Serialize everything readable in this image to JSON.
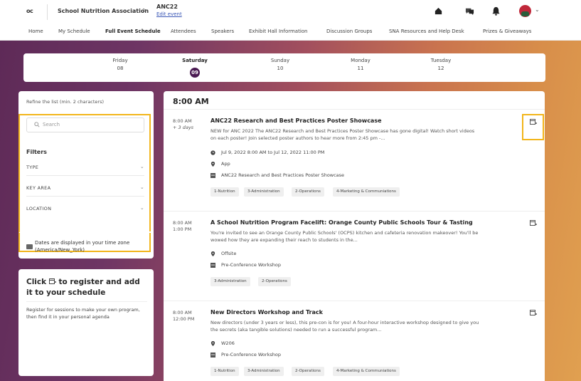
{
  "header": {
    "logo": "oc",
    "org_name": "School Nutrition Association",
    "breadcrumb_chevron": ">",
    "event_name": "ANC22",
    "edit_event": "Edit event"
  },
  "nav": {
    "items": [
      "Home",
      "My Schedule",
      "Full Event Schedule",
      "Attendees",
      "Speakers",
      "Exhibit Hall Information",
      "Discussion Groups",
      "SNA Resources and Help Desk",
      "Prizes & Giveaways"
    ],
    "active": "Full Event Schedule"
  },
  "days": [
    {
      "name": "Friday",
      "num": "08"
    },
    {
      "name": "Saturday",
      "num": "09",
      "selected": true
    },
    {
      "name": "Sunday",
      "num": "10"
    },
    {
      "name": "Monday",
      "num": "11"
    },
    {
      "name": "Tuesday",
      "num": "12"
    }
  ],
  "sidebar": {
    "refine": "Refine the list (min. 2 characters)",
    "search_placeholder": "Search",
    "filters_title": "Filters",
    "filters": [
      "TYPE",
      "KEY AREA",
      "LOCATION"
    ],
    "timezone": "Dates are displayed in your time zone (America/New_York)",
    "register_title_1": "Click",
    "register_title_2": "to register and add it to your schedule",
    "register_text": "Register for sessions to make your own program, then find it in your personal agenda"
  },
  "main": {
    "time_heading": "8:00 AM",
    "sessions": [
      {
        "start": "8:00 AM",
        "end": "+ 3 days",
        "title": "ANC22 Research and Best Practices Poster Showcase",
        "description": "NEW for ANC 2022 The ANC22 Research and Best Practices Poster Showcase has gone digital! Watch short videos on each poster! Join selected poster authors to hear more from 2:45 pm -...",
        "datetime": "Jul 9, 2022 8:00 AM to Jul 12, 2022 11:00 PM",
        "location": "App",
        "track": "ANC22 Research and Best Practices Poster Showcase",
        "tags": [
          "1-Nutrition",
          "3-Administration",
          "2-Operations",
          "4-Marketing & Communiations"
        ]
      },
      {
        "start": "8:00 AM",
        "end": "1:00 PM",
        "title": "A School Nutrition Program Facelift: Orange County Public Schools Tour & Tasting",
        "description": "You're invited to see an Orange County Public Schools' (OCPS) kitchen and cafeteria renovation makeover! You'll be wowed how they are expanding their reach to students in the...",
        "location": "Offsite",
        "track": "Pre-Conference Workshop",
        "tags": [
          "3-Administration",
          "2-Operations"
        ]
      },
      {
        "start": "8:00 AM",
        "end": "12:00 PM",
        "title": "New Directors Workshop and Track",
        "description": "New directors (under 3 years or less), this pre-con is for you! A four-hour interactive workshop designed to give you the secrets (aka tangible solutions) needed to run a successful program...",
        "location": "W206",
        "track": "Pre-Conference Workshop",
        "tags": [
          "1-Nutrition",
          "3-Administration",
          "2-Operations",
          "4-Marketing & Communiations"
        ]
      }
    ]
  },
  "colors": {
    "accent": "#4a1a52",
    "highlight": "#f2b51a",
    "link": "#3a57b6"
  },
  "icons": [
    "home-icon",
    "chat-icon",
    "bell-icon",
    "calendar-add-icon",
    "clock-icon",
    "location-pin-icon",
    "track-icon",
    "globe-icon"
  ]
}
